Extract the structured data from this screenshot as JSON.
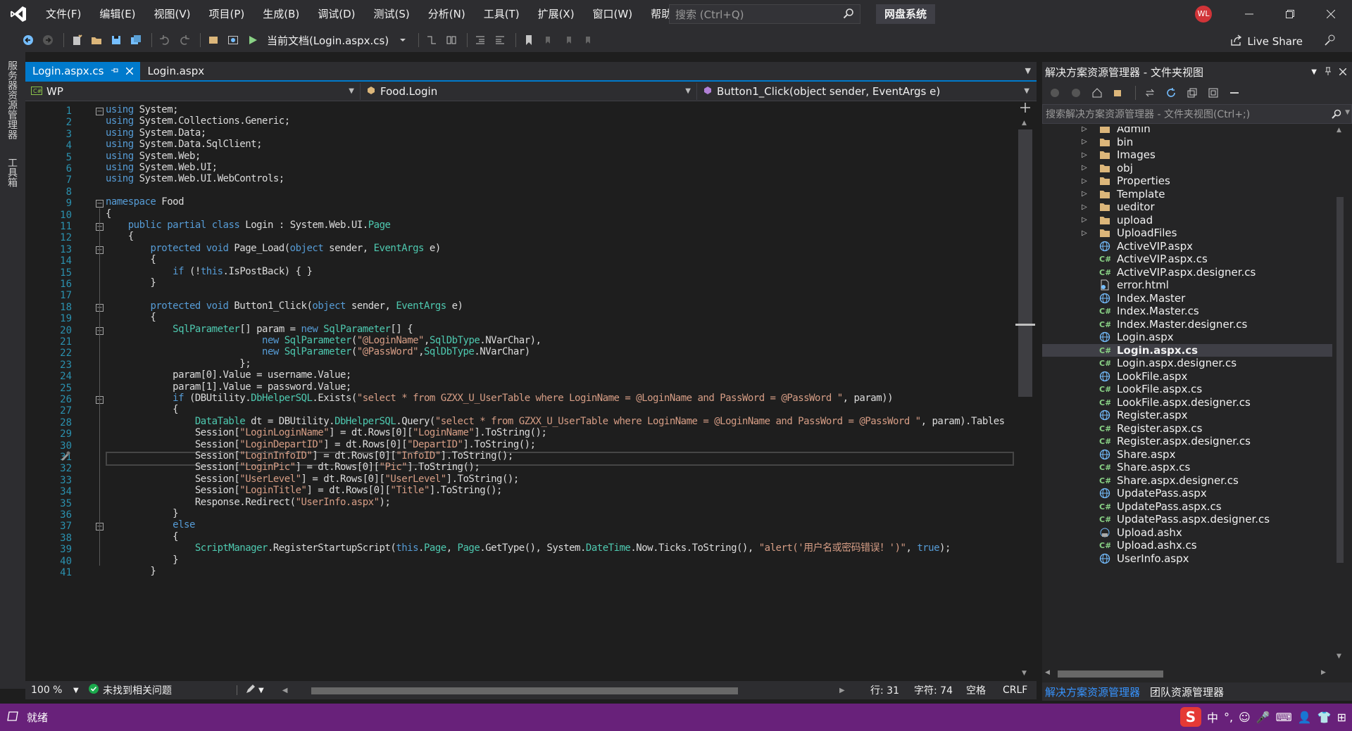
{
  "menu": [
    "文件(F)",
    "编辑(E)",
    "视图(V)",
    "项目(P)",
    "生成(B)",
    "调试(D)",
    "测试(S)",
    "分析(N)",
    "工具(T)",
    "扩展(X)",
    "窗口(W)",
    "帮助(H)"
  ],
  "search": {
    "placeholder": "搜索 (Ctrl+Q)"
  },
  "solution_name": "网盘系统",
  "user_initials": "WL",
  "toolbar": {
    "run_label": "当前文档(Login.aspx.cs)",
    "live_share": "Live Share"
  },
  "left_strip": {
    "server_explorer": "服务器资源管理器",
    "toolbox": "工具箱"
  },
  "tabs": [
    {
      "label": "Login.aspx.cs",
      "active": true
    },
    {
      "label": "Login.aspx",
      "active": false
    }
  ],
  "navbar": {
    "project": "WP",
    "class": "Food.Login",
    "member": "Button1_Click(object sender, EventArgs e)"
  },
  "code_lines": [
    "using System;",
    "using System.Collections.Generic;",
    "using System.Data;",
    "using System.Data.SqlClient;",
    "using System.Web;",
    "using System.Web.UI;",
    "using System.Web.UI.WebControls;",
    "",
    "namespace Food",
    "{",
    "    public partial class Login : System.Web.UI.Page",
    "    {",
    "        protected void Page_Load(object sender, EventArgs e)",
    "        {",
    "            if (!this.IsPostBack) { }",
    "        }",
    "",
    "        protected void Button1_Click(object sender, EventArgs e)",
    "        {",
    "            SqlParameter[] param = new SqlParameter[] {",
    "                            new SqlParameter(\"@LoginName\",SqlDbType.NVarChar),",
    "                            new SqlParameter(\"@PassWord\",SqlDbType.NVarChar)",
    "                        };",
    "            param[0].Value = username.Value;",
    "            param[1].Value = password.Value;",
    "            if (DBUtility.DbHelperSQL.Exists(\"select * from GZXX_U_UserTable where LoginName = @LoginName and PassWord = @PassWord \", param))",
    "            {",
    "                DataTable dt = DBUtility.DbHelperSQL.Query(\"select * from GZXX_U_UserTable where LoginName = @LoginName and PassWord = @PassWord \", param).Tables",
    "                Session[\"LoginLoginName\"] = dt.Rows[0][\"LoginName\"].ToString();",
    "                Session[\"LoginDepartID\"] = dt.Rows[0][\"DepartID\"].ToString();",
    "                Session[\"LoginInfoID\"] = dt.Rows[0][\"InfoID\"].ToString();",
    "                Session[\"LoginPic\"] = dt.Rows[0][\"Pic\"].ToString();",
    "                Session[\"UserLevel\"] = dt.Rows[0][\"UserLevel\"].ToString();",
    "                Session[\"LoginTitle\"] = dt.Rows[0][\"Title\"].ToString();",
    "                Response.Redirect(\"UserInfo.aspx\");",
    "            }",
    "            else",
    "            {",
    "                ScriptManager.RegisterStartupScript(this.Page, Page.GetType(), System.DateTime.Now.Ticks.ToString(), \"alert('用户名或密码错误！')\", true);",
    "            }",
    "        }"
  ],
  "current_line": 31,
  "editor_status": {
    "zoom": "100 %",
    "issues": "未找到相关问题",
    "line": "行: 31",
    "col": "字符: 74",
    "spaces": "空格",
    "eol": "CRLF"
  },
  "solution_explorer": {
    "title": "解决方案资源管理器 - 文件夹视图",
    "search_placeholder": "搜索解决方案资源管理器 - 文件夹视图(Ctrl+;)",
    "items": [
      {
        "label": "Admin",
        "type": "folder"
      },
      {
        "label": "bin",
        "type": "folder"
      },
      {
        "label": "Images",
        "type": "folder"
      },
      {
        "label": "obj",
        "type": "folder"
      },
      {
        "label": "Properties",
        "type": "folder"
      },
      {
        "label": "Template",
        "type": "folder"
      },
      {
        "label": "ueditor",
        "type": "folder"
      },
      {
        "label": "upload",
        "type": "folder"
      },
      {
        "label": "UploadFiles",
        "type": "folder"
      },
      {
        "label": "ActiveVIP.aspx",
        "type": "web"
      },
      {
        "label": "ActiveVIP.aspx.cs",
        "type": "cs"
      },
      {
        "label": "ActiveVIP.aspx.designer.cs",
        "type": "cs"
      },
      {
        "label": "error.html",
        "type": "html"
      },
      {
        "label": "Index.Master",
        "type": "web"
      },
      {
        "label": "Index.Master.cs",
        "type": "cs"
      },
      {
        "label": "Index.Master.designer.cs",
        "type": "cs"
      },
      {
        "label": "Login.aspx",
        "type": "web"
      },
      {
        "label": "Login.aspx.cs",
        "type": "cs",
        "selected": true
      },
      {
        "label": "Login.aspx.designer.cs",
        "type": "cs"
      },
      {
        "label": "LookFile.aspx",
        "type": "web"
      },
      {
        "label": "LookFile.aspx.cs",
        "type": "cs"
      },
      {
        "label": "LookFile.aspx.designer.cs",
        "type": "cs"
      },
      {
        "label": "Register.aspx",
        "type": "web"
      },
      {
        "label": "Register.aspx.cs",
        "type": "cs"
      },
      {
        "label": "Register.aspx.designer.cs",
        "type": "cs"
      },
      {
        "label": "Share.aspx",
        "type": "web"
      },
      {
        "label": "Share.aspx.cs",
        "type": "cs"
      },
      {
        "label": "Share.aspx.designer.cs",
        "type": "cs"
      },
      {
        "label": "UpdatePass.aspx",
        "type": "web"
      },
      {
        "label": "UpdatePass.aspx.cs",
        "type": "cs"
      },
      {
        "label": "UpdatePass.aspx.designer.cs",
        "type": "cs"
      },
      {
        "label": "Upload.ashx",
        "type": "ashx"
      },
      {
        "label": "Upload.ashx.cs",
        "type": "cs"
      },
      {
        "label": "UserInfo.aspx",
        "type": "web"
      }
    ],
    "tabs": [
      "解决方案资源管理器",
      "团队资源管理器"
    ]
  },
  "statusbar": {
    "ready": "就绪"
  },
  "ime": [
    "中",
    "°,",
    "☺",
    "🎤",
    "⌨",
    "👤",
    "👕",
    "⊞"
  ],
  "colors": {
    "accent": "#007acc",
    "statusbar": "#68217a",
    "keyword": "#569cd6",
    "type": "#4ec9b0",
    "string": "#d69d85",
    "linenumber": "#2b91af"
  }
}
